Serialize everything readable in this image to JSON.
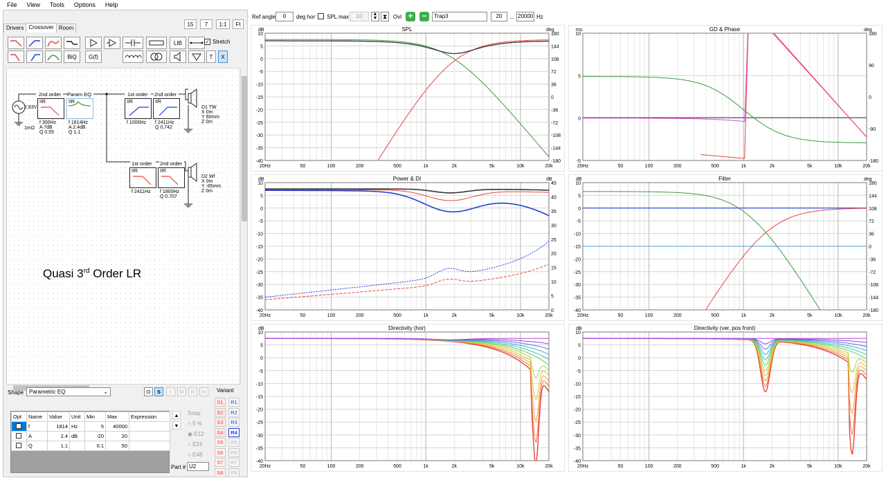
{
  "menu": [
    "File",
    "View",
    "Tools",
    "Options",
    "Help"
  ],
  "tabs": [
    "Drivers",
    "Crossover",
    "Room"
  ],
  "zoom_buttons": [
    "15",
    "7",
    "1:1",
    "Ft"
  ],
  "toolbar": {
    "biq": "BiQ",
    "gf": "G(f)",
    "lib": "LIB",
    "t": "T",
    "x": "X",
    "stretch_label": "Stretch"
  },
  "schematic": {
    "source_voltage": "2.83V",
    "ground_res": "1mΩ",
    "annotation_main": "Quasi 3",
    "annotation_sup": "rd",
    "annotation_rest": " Order LR",
    "blocks": [
      {
        "title": "2nd order",
        "type": "IIR",
        "params": [
          "f  300Hz",
          "A  7dB",
          "Q  0.55"
        ]
      },
      {
        "title": "Param EQ",
        "type": "IIR",
        "params": [
          "f  1814Hz",
          "A  2.4dB",
          "Q  1.1"
        ]
      },
      {
        "title": "1st order",
        "type": "IIR",
        "params": [
          "f  1000Hz"
        ]
      },
      {
        "title": "2nd order",
        "type": "IIR",
        "params": [
          "f  2411Hz",
          "Q  0.742"
        ]
      },
      {
        "title": "1st order",
        "type": "IIR",
        "params": [
          "f  2411Hz"
        ]
      },
      {
        "title": "2nd order",
        "type": "IIR",
        "params": [
          "f  1800Hz",
          "Q  0.707"
        ]
      }
    ],
    "drivers": [
      {
        "name": "D1 TW",
        "params": [
          "X 0m",
          "Y 60mm",
          "Z 0m"
        ]
      },
      {
        "name": "D2 Wf",
        "params": [
          "X 0m",
          "Y -85mm",
          "Z 0m"
        ]
      }
    ]
  },
  "shape": {
    "label": "Shape",
    "value": "Parametric EQ"
  },
  "mode_buttons": [
    "O",
    "S",
    "I",
    "M",
    "R",
    "H"
  ],
  "param_table": {
    "headers": [
      "Opt",
      "Name",
      "Value",
      "Unit",
      "Min",
      "Max",
      "Expression"
    ],
    "rows": [
      {
        "name": "f",
        "value": "1814",
        "unit": "Hz",
        "min": "5",
        "max": "40000",
        "expr": ""
      },
      {
        "name": "A",
        "value": "2.4",
        "unit": "dB",
        "min": "-20",
        "max": "20",
        "expr": ""
      },
      {
        "name": "Q",
        "value": "1.1",
        "unit": "",
        "min": "0.1",
        "max": "50",
        "expr": ""
      }
    ]
  },
  "snap": {
    "label": "Snap",
    "options": [
      "5 %",
      "E12",
      "E24",
      "E48"
    ]
  },
  "part": {
    "label": "Part #",
    "value": "U2"
  },
  "variant": {
    "label": "Variant",
    "s": [
      "S1",
      "S2",
      "S3",
      "S4",
      "S5",
      "S6",
      "S7",
      "S8"
    ],
    "r": [
      "R1",
      "R2",
      "R3",
      "R4",
      "R5",
      "R6",
      "R7",
      "R8"
    ]
  },
  "topbar": {
    "ref_angle_label": "Ref angle",
    "ref_angle_value": "0",
    "deg_hor": "deg hor",
    "spl_max_label": "SPL max",
    "spl_max_value": "10",
    "ovl": "Ovl",
    "name_value": "Trap3",
    "f_lo": "20",
    "dots": "...",
    "f_hi": "20000",
    "hz": "Hz"
  },
  "x_ticks": [
    "20Hz",
    "50",
    "100",
    "200",
    "500",
    "1k",
    "2k",
    "5k",
    "10k",
    "20k"
  ],
  "panels": {
    "spl": {
      "title": "SPL",
      "unit_left": "dB",
      "unit_right": "deg",
      "left_ticks": [
        "10",
        "5",
        "0",
        "-5",
        "-10",
        "-15",
        "-20",
        "-25",
        "-30",
        "-35",
        "-40"
      ],
      "right_ticks": [
        "180",
        "144",
        "108",
        "72",
        "36",
        "0",
        "-36",
        "-72",
        "-108",
        "-144",
        "-180"
      ]
    },
    "gd": {
      "title": "GD & Phase",
      "unit_left": "ms",
      "unit_right": "deg",
      "left_ticks": [
        "10",
        "5",
        "0",
        "-5"
      ],
      "right_ticks": [
        "180",
        "90",
        "0",
        "-90",
        "-180"
      ]
    },
    "power": {
      "title": "Power & DI",
      "unit_left": "dB",
      "unit_right": "dB",
      "left_ticks": [
        "10",
        "5",
        "0",
        "-5",
        "-10",
        "-15",
        "-20",
        "-25",
        "-30",
        "-35",
        "-40"
      ],
      "right_ticks": [
        "45",
        "40",
        "35",
        "30",
        "25",
        "20",
        "15",
        "10",
        "5",
        "0"
      ]
    },
    "filter": {
      "title": "Filter",
      "unit_left": "dB",
      "unit_right": "deg",
      "left_ticks": [
        "10",
        "5",
        "0",
        "-5",
        "-10",
        "-15",
        "-20",
        "-25",
        "-30",
        "-35",
        "-40"
      ],
      "right_ticks": [
        "180",
        "144",
        "108",
        "72",
        "36",
        "0",
        "-36",
        "-72",
        "-108",
        "-144",
        "-180"
      ]
    },
    "dirh": {
      "title": "Directivity (hor)",
      "unit_left": "dB",
      "left_ticks": [
        "10",
        "5",
        "0",
        "-5",
        "-10",
        "-15",
        "-20",
        "-25",
        "-30",
        "-35",
        "-40"
      ]
    },
    "dirv": {
      "title": "Directivity (ver, pos front)",
      "unit_left": "dB",
      "left_ticks": [
        "10",
        "5",
        "0",
        "-5",
        "-10",
        "-15",
        "-20",
        "-25",
        "-30",
        "-35",
        "-40"
      ]
    }
  },
  "colors": {
    "red": "#e8453c",
    "green": "#3c9a3c",
    "black": "#333333",
    "blue": "#1f3fd8",
    "magenta": "#e040e0",
    "lightblue": "#3da0e8",
    "grid": "#d8d8d8"
  }
}
